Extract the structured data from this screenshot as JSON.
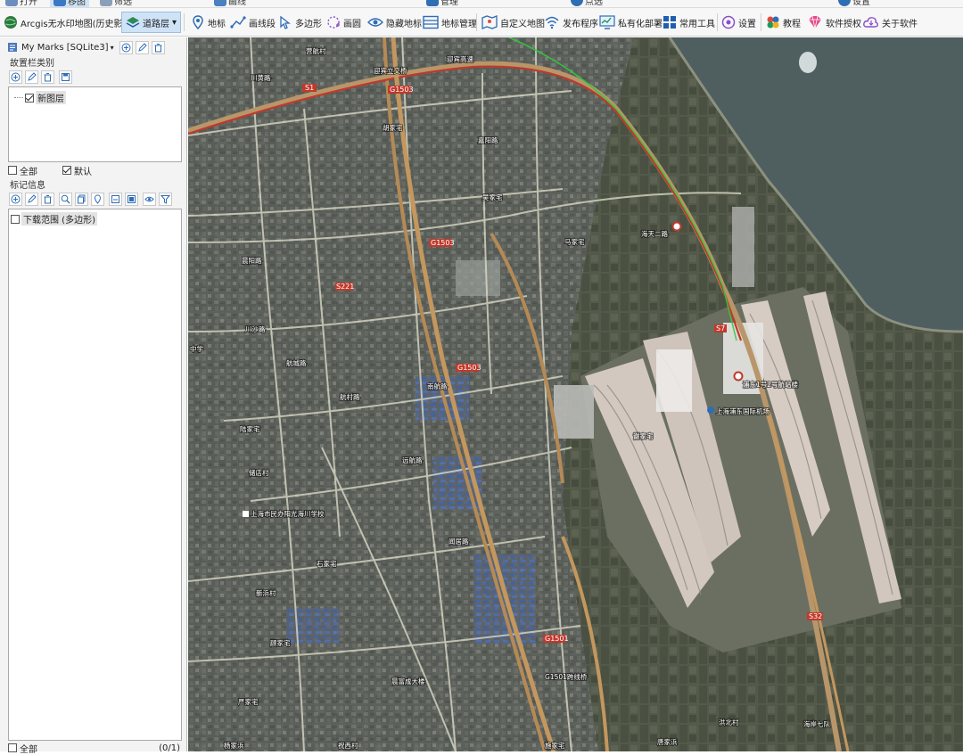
{
  "toolbar": {
    "map_source": "Arcgis无水印地图(历史影像)",
    "layer_btn": "道路层",
    "items": [
      "地标",
      "画线段",
      "多边形",
      "画圆",
      "隐藏地标",
      "地标管理",
      "自定义地图",
      "发布程序",
      "私有化部署",
      "常用工具",
      "设置",
      "教程",
      "软件授权",
      "关于软件"
    ]
  },
  "top_strip": {
    "items": [
      "打开",
      "移图",
      "筛选",
      "画线",
      "管理",
      "点选",
      "设置"
    ]
  },
  "left_panel": {
    "db_title": "My Marks [SQLite3]",
    "section_layers": "故置栏类别",
    "layer_item": "新图层",
    "check_all": "全部",
    "check_default": "默认",
    "section_marks": "标记信息",
    "mark_item": "下载范围 (多边形)",
    "footer_all": "全部",
    "footer_count": "(0/1)"
  },
  "colors": {
    "toolbar_bg": "#f7f7f7",
    "active_bg": "#cfe3f7",
    "map_base": "#4f5447",
    "road": "#d9d9c6",
    "highway": "#b58a55",
    "metro": "#c0392b",
    "runway": "#d3c8bf"
  },
  "map": {
    "labels": [
      "营航村",
      "迎宾高速",
      "迎宾立交桥",
      "川黄路",
      "胡家宅",
      "嘉阳路",
      "吴家宅",
      "海天二路",
      "马家宅",
      "浦东1号2号航站楼",
      "上海浦东国际机场",
      "谢家宅",
      "航城路",
      "陆家宅",
      "储店村",
      "上海市民办阳光海川学校",
      "石家宅",
      "新浜村",
      "顾家宅",
      "严家宅",
      "杨家浜",
      "祝西村",
      "施家宅",
      "洪北村",
      "唐家浜",
      "海岸七队",
      "G1501跨线桥",
      "晨阳路",
      "川沙路",
      "晨富成大楼",
      "闻居路",
      "远航路",
      "南航路",
      "航村路",
      "中学"
    ],
    "shields": [
      "S1",
      "G1503",
      "S221",
      "S7",
      "S32",
      "G1501"
    ]
  }
}
